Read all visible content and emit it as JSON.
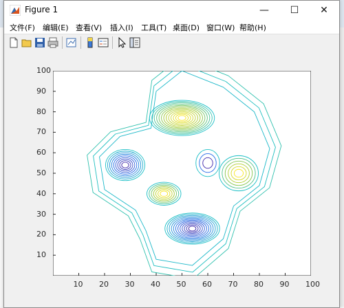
{
  "window": {
    "title": "Figure 1",
    "controls": {
      "minimize": "—",
      "maximize": "☐",
      "close": "✕"
    }
  },
  "menus": [
    "文件(F)",
    "编辑(E)",
    "查看(V)",
    "插入(I)",
    "工具(T)",
    "桌面(D)",
    "窗口(W)",
    "帮助(H)"
  ],
  "toolbar_icons": [
    "new-figure-icon",
    "open-file-icon",
    "save-icon",
    "print-icon",
    "link-plot-icon",
    "insert-colorbar-icon",
    "insert-legend-icon",
    "pointer-icon",
    "property-editor-icon"
  ],
  "chart_data": {
    "type": "contour",
    "title": "",
    "xlabel": "",
    "ylabel": "",
    "xlim": [
      0,
      100
    ],
    "ylim": [
      0,
      100
    ],
    "xticks": [
      "10",
      "20",
      "30",
      "40",
      "50",
      "60",
      "70",
      "80",
      "90",
      "100"
    ],
    "yticks": [
      "10",
      "20",
      "30",
      "40",
      "50",
      "60",
      "70",
      "80",
      "90",
      "100"
    ],
    "colormap": "parula",
    "peaks": [
      {
        "x": 50,
        "y": 77,
        "rx": 12,
        "ry": 8,
        "sign": "high",
        "levels": 13
      },
      {
        "x": 72,
        "y": 50,
        "rx": 7,
        "ry": 8,
        "sign": "high",
        "levels": 6
      },
      {
        "x": 43,
        "y": 40,
        "rx": 6,
        "ry": 5,
        "sign": "high",
        "levels": 7
      },
      {
        "x": 28,
        "y": 54,
        "rx": 7,
        "ry": 7,
        "sign": "low",
        "levels": 9
      },
      {
        "x": 54,
        "y": 23,
        "rx": 10,
        "ry": 7,
        "sign": "low",
        "levels": 12
      },
      {
        "x": 60,
        "y": 55,
        "rx": 4,
        "ry": 6,
        "sign": "low",
        "levels": 3
      }
    ],
    "outer_contours": 3,
    "grid": false,
    "legend": "none"
  }
}
